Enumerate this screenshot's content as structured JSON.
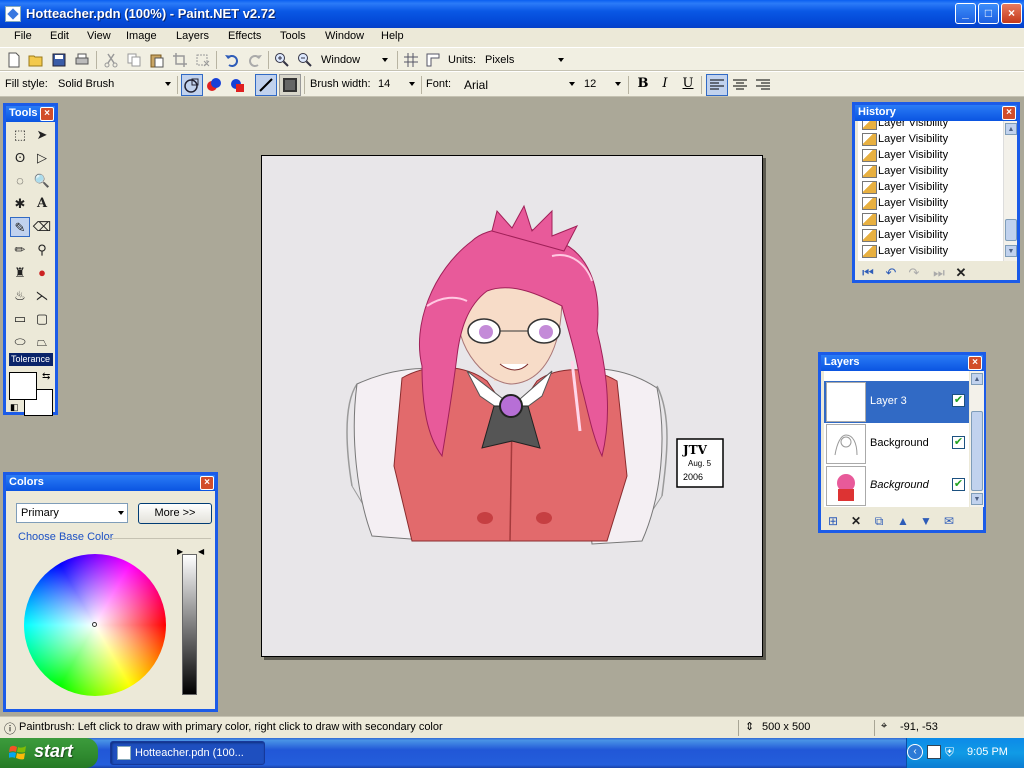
{
  "window": {
    "title": "Hotteacher.pdn (100%) - Paint.NET v2.72",
    "min": "_",
    "max": "□",
    "close": "×"
  },
  "menu": [
    "File",
    "Edit",
    "View",
    "Image",
    "Layers",
    "Effects",
    "Tools",
    "Window",
    "Help"
  ],
  "toolbar": {
    "window_combo": "Window",
    "units_label": "Units:",
    "units_value": "Pixels",
    "fill_style_label": "Fill style:",
    "fill_style_value": "Solid Brush",
    "brush_width_label": "Brush width:",
    "brush_width_value": "14",
    "font_label": "Font:",
    "font_value": "Arial",
    "font_size_value": "12",
    "bold": "B",
    "italic": "I",
    "underline": "U"
  },
  "tools_panel": {
    "title": "Tools",
    "tolerance_label": "Tolerance"
  },
  "colors_panel": {
    "title": "Colors",
    "mode_value": "Primary",
    "more_button": "More >>",
    "base_color_label": "Choose Base Color",
    "primary_color": "#ffffff",
    "secondary_color": "#ffffff"
  },
  "history_panel": {
    "title": "History",
    "items": [
      "Layer Visibility",
      "Layer Visibility",
      "Layer Visibility",
      "Layer Visibility",
      "Layer Visibility",
      "Layer Visibility",
      "Layer Visibility",
      "Layer Visibility",
      "Layer Visibility",
      "Layer Visibility"
    ]
  },
  "layers_panel": {
    "title": "Layers",
    "layers": [
      {
        "name": "Layer 3",
        "visible": true,
        "selected": true
      },
      {
        "name": "Background",
        "visible": true,
        "selected": false
      },
      {
        "name": "Background",
        "visible": true,
        "selected": false
      }
    ]
  },
  "canvas": {
    "signature_initials": "JTV",
    "signature_date_1": "Aug. 5",
    "signature_date_2": "2006"
  },
  "status": {
    "hint": "Paintbrush: Left click to draw with primary color, right click to draw with secondary color",
    "image_size": "500 x 500",
    "cursor_position": "-91, -53"
  },
  "taskbar": {
    "start_label": "start",
    "task_label": "Hotteacher.pdn (100...",
    "clock": "9:05 PM"
  },
  "colors": {
    "titlebar_blue": "#0a58e5",
    "workspace": "#aba898",
    "hair_pink": "#e85a9a",
    "vest_red": "#e26a6c",
    "selection_blue": "#316ac5"
  }
}
